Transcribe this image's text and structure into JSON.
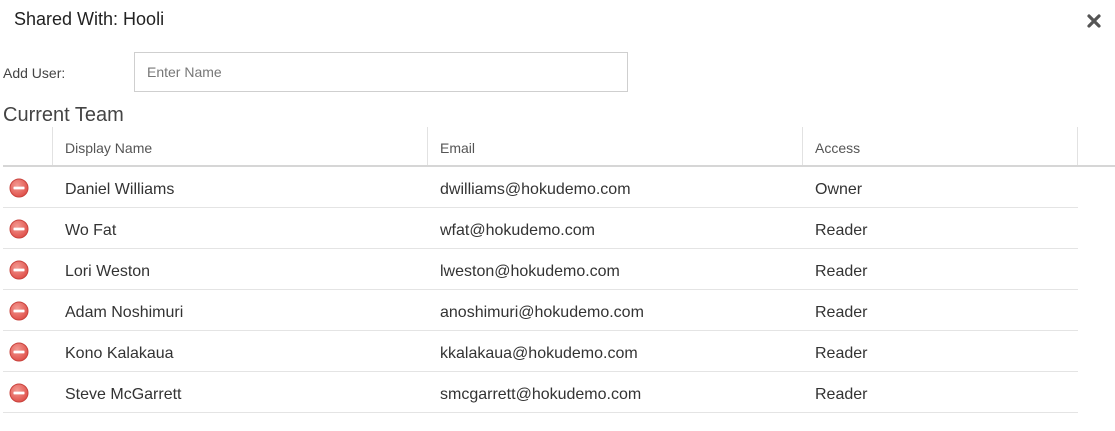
{
  "dialog": {
    "title": "Shared With: Hooli",
    "close_icon": "close-icon"
  },
  "add_user": {
    "label": "Add User:",
    "placeholder": "Enter Name",
    "value": ""
  },
  "team": {
    "title": "Current Team",
    "columns": [
      "Display Name",
      "Email",
      "Access"
    ],
    "remove_icon": "remove-circle-icon",
    "remove_icon_color": "#e0524c",
    "rows": [
      {
        "name": "Daniel Williams",
        "email": "dwilliams@hokudemo.com",
        "access": "Owner"
      },
      {
        "name": "Wo Fat",
        "email": "wfat@hokudemo.com",
        "access": "Reader"
      },
      {
        "name": "Lori Weston",
        "email": "lweston@hokudemo.com",
        "access": "Reader"
      },
      {
        "name": "Adam Noshimuri",
        "email": "anoshimuri@hokudemo.com",
        "access": "Reader"
      },
      {
        "name": "Kono Kalakaua",
        "email": "kkalakaua@hokudemo.com",
        "access": "Reader"
      },
      {
        "name": "Steve McGarrett",
        "email": "smcgarrett@hokudemo.com",
        "access": "Reader"
      }
    ]
  }
}
